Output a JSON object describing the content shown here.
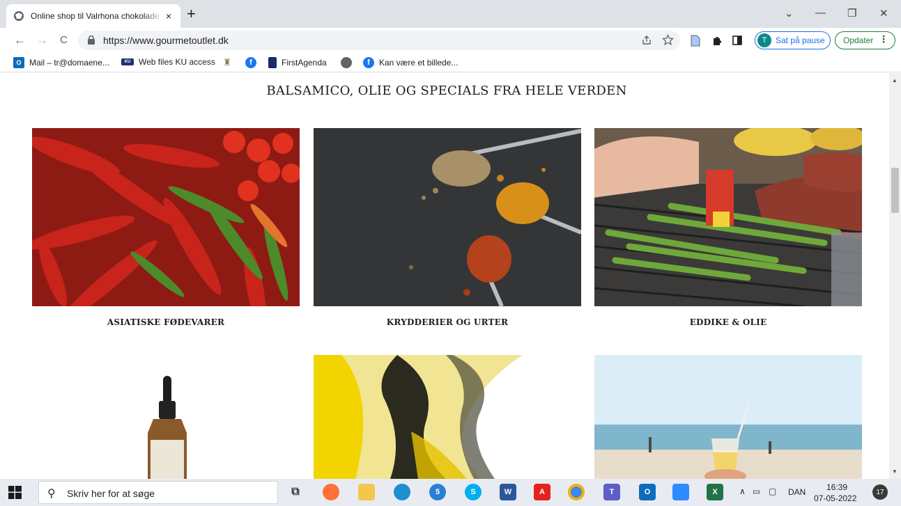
{
  "browser": {
    "tab_title": "Online shop til Valrhona chokolade",
    "tab_close": "×",
    "new_tab": "+",
    "window_controls": {
      "dropdown": "⌄",
      "minimize": "—",
      "restore": "❐",
      "close": "✕"
    },
    "nav": {
      "back": "←",
      "forward": "→",
      "reload": "C"
    },
    "url": "https://www.gourmetoutlet.dk",
    "profile_initial": "T",
    "profile_label": "Sat på pause",
    "update_label": "Opdater",
    "update_menu": "⋮"
  },
  "bookmarks": [
    {
      "label": "Mail – tr@domaene...",
      "icon": "outlook-icon",
      "color": "#0f6cbd"
    },
    {
      "label": "Web files KU access",
      "icon": "ku-icon",
      "color": "#20306b"
    },
    {
      "label": "",
      "icon": "crest-icon",
      "color": "#8a7a50"
    },
    {
      "label": "",
      "icon": "facebook-icon",
      "color": "#1877f2"
    },
    {
      "label": "FirstAgenda",
      "icon": "firstagenda-icon",
      "color": "#1b2a6b"
    },
    {
      "label": "",
      "icon": "globe-icon",
      "color": "#5f6368"
    },
    {
      "label": "Kan være et billede...",
      "icon": "facebook-icon",
      "color": "#1877f2"
    }
  ],
  "page": {
    "heading": "BALSAMICO, OLIE OG SPECIALS FRA HELE VERDEN",
    "categories": [
      {
        "caption": "ASIATISKE FØDEVARER",
        "image": "chili-peppers"
      },
      {
        "caption": "KRYDDERIER OG URTER",
        "image": "spice-spoons"
      },
      {
        "caption": "EDDIKE & OLIE",
        "image": "grilled-asparagus"
      },
      {
        "caption": "",
        "image": "dropper-bottle"
      },
      {
        "caption": "",
        "image": "ink-in-water"
      },
      {
        "caption": "",
        "image": "beach-drink"
      }
    ]
  },
  "taskbar": {
    "search_placeholder": "Skriv her for at søge",
    "apps": [
      {
        "name": "task-view",
        "color": "#e8ecf2",
        "label": ""
      },
      {
        "name": "firefox",
        "color": "#ff7139",
        "label": ""
      },
      {
        "name": "file-explorer",
        "color": "#f4c64b",
        "label": ""
      },
      {
        "name": "edge",
        "color": "#1c8fd1",
        "label": ""
      },
      {
        "name": "app-badge-5",
        "color": "#2a7fd4",
        "label": "5"
      },
      {
        "name": "skype",
        "color": "#00aff0",
        "label": "S"
      },
      {
        "name": "word",
        "color": "#2b579a",
        "label": "W"
      },
      {
        "name": "acrobat",
        "color": "#e3241b",
        "label": "A"
      },
      {
        "name": "chrome",
        "color": "#4285f4",
        "label": ""
      },
      {
        "name": "teams",
        "color": "#5b5fc7",
        "label": "T"
      },
      {
        "name": "outlook",
        "color": "#0f6cbd",
        "label": "O"
      },
      {
        "name": "zoom",
        "color": "#2d8cff",
        "label": ""
      },
      {
        "name": "excel",
        "color": "#217346",
        "label": "X"
      }
    ],
    "language": "DAN",
    "time": "16:39",
    "date": "07-05-2022",
    "notifications": "17"
  }
}
